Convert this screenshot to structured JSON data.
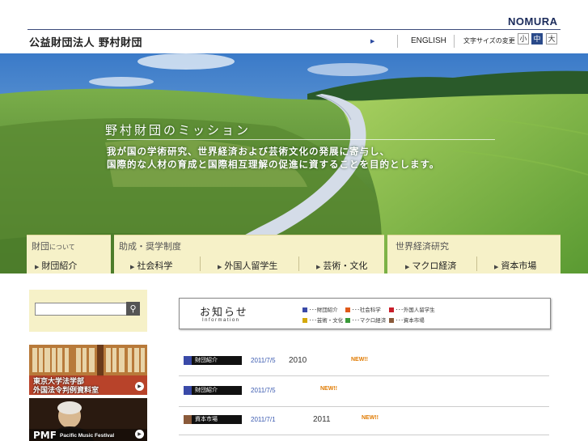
{
  "header": {
    "brand": "NOMURA",
    "org_name": "公益財団法人 野村財団",
    "english_label": "ENGLISH",
    "font_size_label": "文字サイズの変更",
    "font_sizes": [
      "小",
      "中",
      "大"
    ],
    "font_size_selected": "中"
  },
  "hero": {
    "title": "野村財団のミッション",
    "lines": [
      "我が国の学術研究、世界経済および芸術文化の発展に寄与し、",
      "国際的な人材の育成と国際相互理解の促進に資することを目的とします。"
    ]
  },
  "nav": {
    "about": {
      "head": "財団",
      "head_small": "について",
      "links": [
        "財団紹介"
      ]
    },
    "grants": {
      "head": "助成・奨学制度",
      "links": [
        "社会科学",
        "外国人留学生",
        "芸術・文化"
      ]
    },
    "research": {
      "head": "世界経済研究",
      "links": [
        "マクロ経済",
        "資本市場"
      ]
    }
  },
  "banners": [
    {
      "line1": "東京大学法学部",
      "line2": "外国法令判例資料室"
    },
    {
      "big": "PMF",
      "small": "Pacific Music Festival"
    }
  ],
  "news": {
    "title": "お知らせ",
    "subtitle": "Information",
    "legend": [
      {
        "label": "･･･財団紹介",
        "color": "#3a4aa8"
      },
      {
        "label": "･･･社会科学",
        "color": "#e05a1a"
      },
      {
        "label": "･･･外国人留学生",
        "color": "#c81e2a"
      },
      {
        "label": "･･･芸術・文化",
        "color": "#d4a80a"
      },
      {
        "label": "･･･マクロ経済",
        "color": "#3a9a3a"
      },
      {
        "label": "･･･資本市場",
        "color": "#8a5a3a"
      }
    ],
    "items": [
      {
        "tag": "財団紹介",
        "tag_color": "#3a4aa8",
        "date": "2011/7/5",
        "title": "2010",
        "new": "NEW!!"
      },
      {
        "tag": "財団紹介",
        "tag_color": "#3a4aa8",
        "date": "2011/7/5",
        "title": "",
        "new": "NEW!!"
      },
      {
        "tag": "資本市場",
        "tag_color": "#8a5a3a",
        "date": "2011/7/1",
        "title": "2011",
        "new": "NEW!!"
      }
    ]
  }
}
